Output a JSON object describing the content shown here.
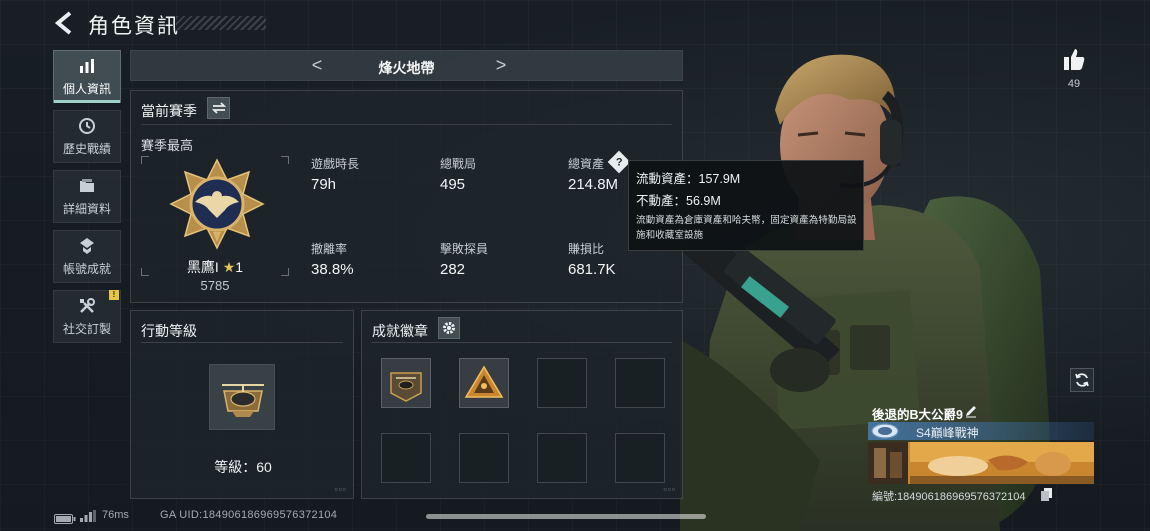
{
  "header": {
    "title": "角色資訊"
  },
  "sidebar": {
    "items": [
      {
        "label": "個人資訊",
        "icon": "bar-chart-icon",
        "active": true
      },
      {
        "label": "歷史戰績",
        "icon": "history-clock-icon"
      },
      {
        "label": "詳細資料",
        "icon": "folder-icon"
      },
      {
        "label": "帳號成就",
        "icon": "achievement-medal-icon"
      },
      {
        "label": "社交訂製",
        "icon": "tools-icon",
        "badge": "!"
      }
    ]
  },
  "map_nav": {
    "prev": "<",
    "current": "烽火地帶",
    "next": ">"
  },
  "season": {
    "header": "當前賽季",
    "best_label": "賽季最高",
    "rank": {
      "name": "黑鷹I",
      "star_level": "1",
      "score": "5785"
    },
    "stats": [
      {
        "label": "遊戲時長",
        "value": "79h"
      },
      {
        "label": "總戰局",
        "value": "495"
      },
      {
        "label": "總資產",
        "value": "214.8M"
      },
      {
        "label": "撤離率",
        "value": "38.8%"
      },
      {
        "label": "擊敗探員",
        "value": "282"
      },
      {
        "label": "賺損比",
        "value": "681.7K"
      }
    ]
  },
  "tooltip": {
    "line1": "流動資產：157.9M",
    "line2": "不動產：56.9M",
    "description": "流動資產為倉庫資產和哈夫幣，固定資產為特勤局設施和收藏室設施"
  },
  "action_level": {
    "title": "行動等級",
    "level_text": "等級：60"
  },
  "achievements": {
    "title": "成就徽章",
    "filled_slots": 2,
    "total_slots": 8
  },
  "profile": {
    "likes": "49",
    "player_name": "後退的B大公爵9",
    "player_title": "S4巔峰戰神",
    "player_id": "編號:184906186969576372104"
  },
  "status_bar": {
    "latency": "76ms",
    "uid": "GA UID:184906186969576372104"
  },
  "colors": {
    "accent": "#9fd2c6",
    "badge": "#e8c64a",
    "gold": "#c9a04a"
  }
}
